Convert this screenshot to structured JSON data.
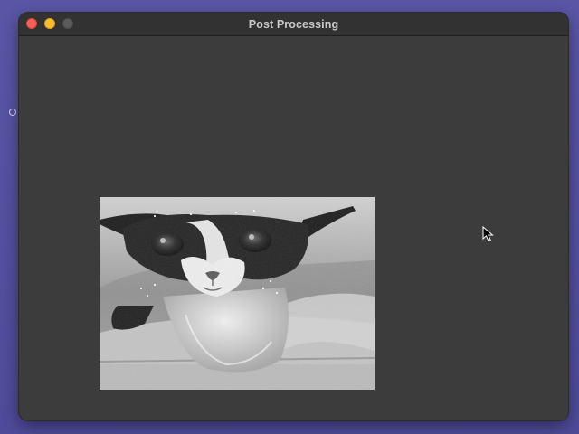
{
  "window": {
    "title": "Post Processing"
  },
  "viewport": {
    "image_description_icon": "processed-cat-image"
  },
  "colors": {
    "window_bg": "#3c3c3c",
    "titlebar_bg": "#323232",
    "title_text": "#c9c9c9",
    "close": "#fe5f57",
    "minimize": "#febc2e",
    "zoom_disabled": "#5b5b5b",
    "desktop_bg": "#524e9e"
  }
}
